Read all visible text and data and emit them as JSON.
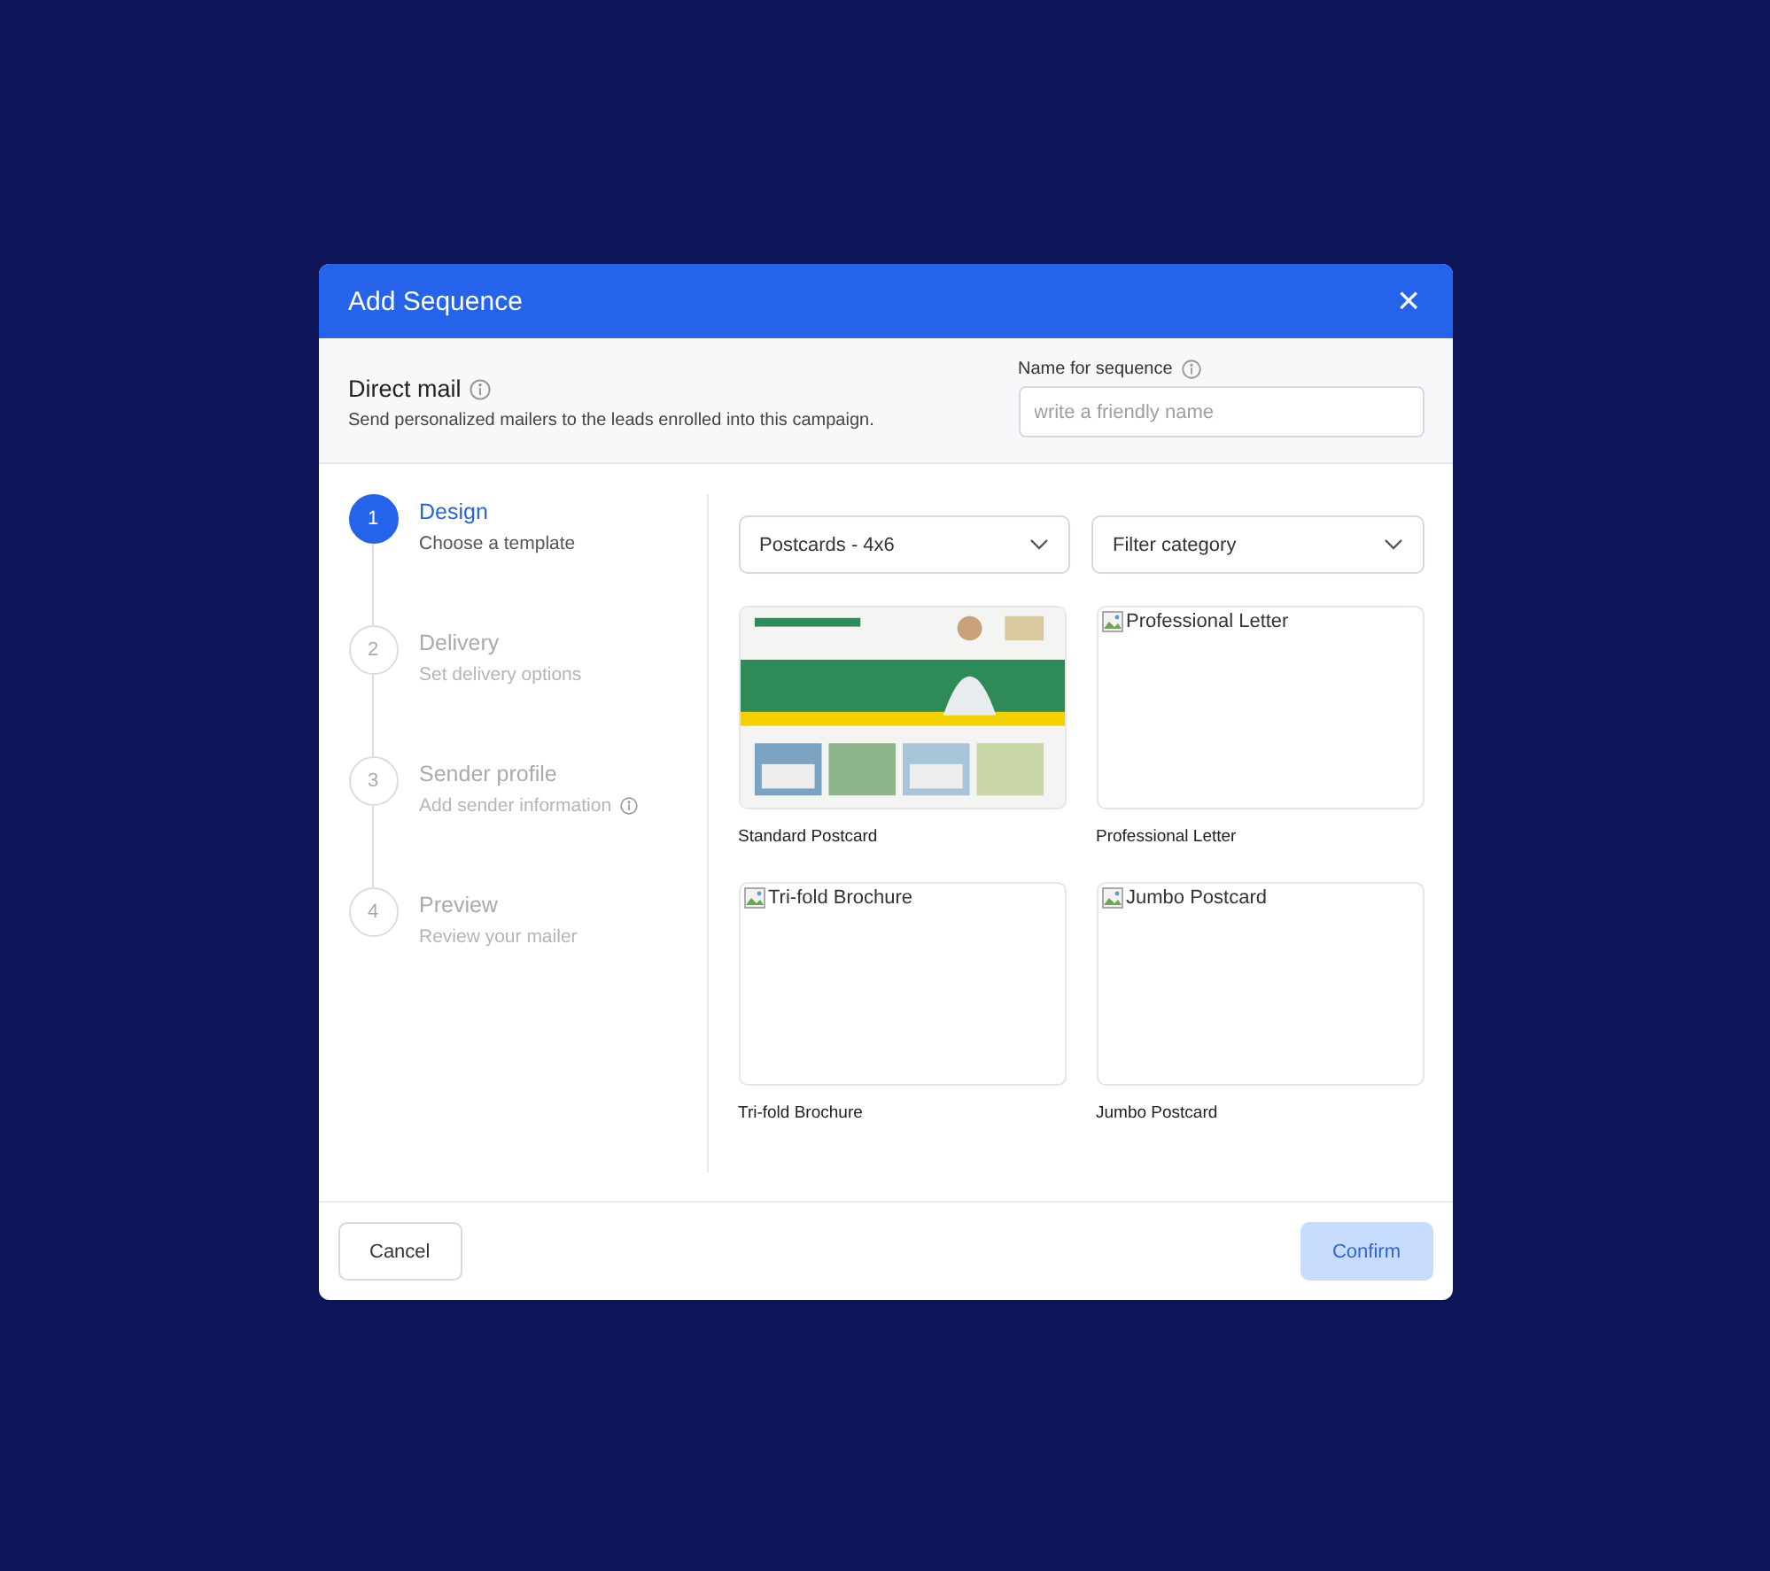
{
  "dialog": {
    "title": "Add Sequence",
    "close": "×"
  },
  "intro": {
    "title": "Direct mail",
    "description": "Send personalized mailers to the leads enrolled into this campaign.",
    "name_field": {
      "label": "Name for sequence",
      "placeholder": "write a friendly name"
    }
  },
  "steps": [
    {
      "number": "1",
      "title": "Design",
      "subtitle": "Choose a template",
      "selected": true,
      "has_info": false
    },
    {
      "number": "2",
      "title": "Delivery",
      "subtitle": "Set delivery options",
      "selected": false,
      "has_info": false
    },
    {
      "number": "3",
      "title": "Sender profile",
      "subtitle": "Add sender information",
      "selected": false,
      "has_info": true
    },
    {
      "number": "4",
      "title": "Preview",
      "subtitle": "Review your mailer",
      "selected": false,
      "has_info": false
    }
  ],
  "filters": [
    {
      "value": "Postcards - 4x6"
    },
    {
      "value": "Filter category"
    }
  ],
  "template_rows": [
    {
      "templates": [
        {
          "kind": "picture",
          "name": "Standard Postcard"
        },
        {
          "kind": "broken",
          "alt": "Professional Letter",
          "name": "Professional Letter"
        }
      ]
    },
    {
      "templates": [
        {
          "kind": "broken",
          "alt": "Tri-fold Brochure",
          "name": "Tri-fold Brochure"
        },
        {
          "kind": "broken",
          "alt": "Jumbo Postcard",
          "name": "Jumbo Postcard"
        }
      ]
    }
  ],
  "footer": {
    "cancel": "Cancel",
    "confirm": {
      "label": "Confirm",
      "disabled": true
    }
  }
}
